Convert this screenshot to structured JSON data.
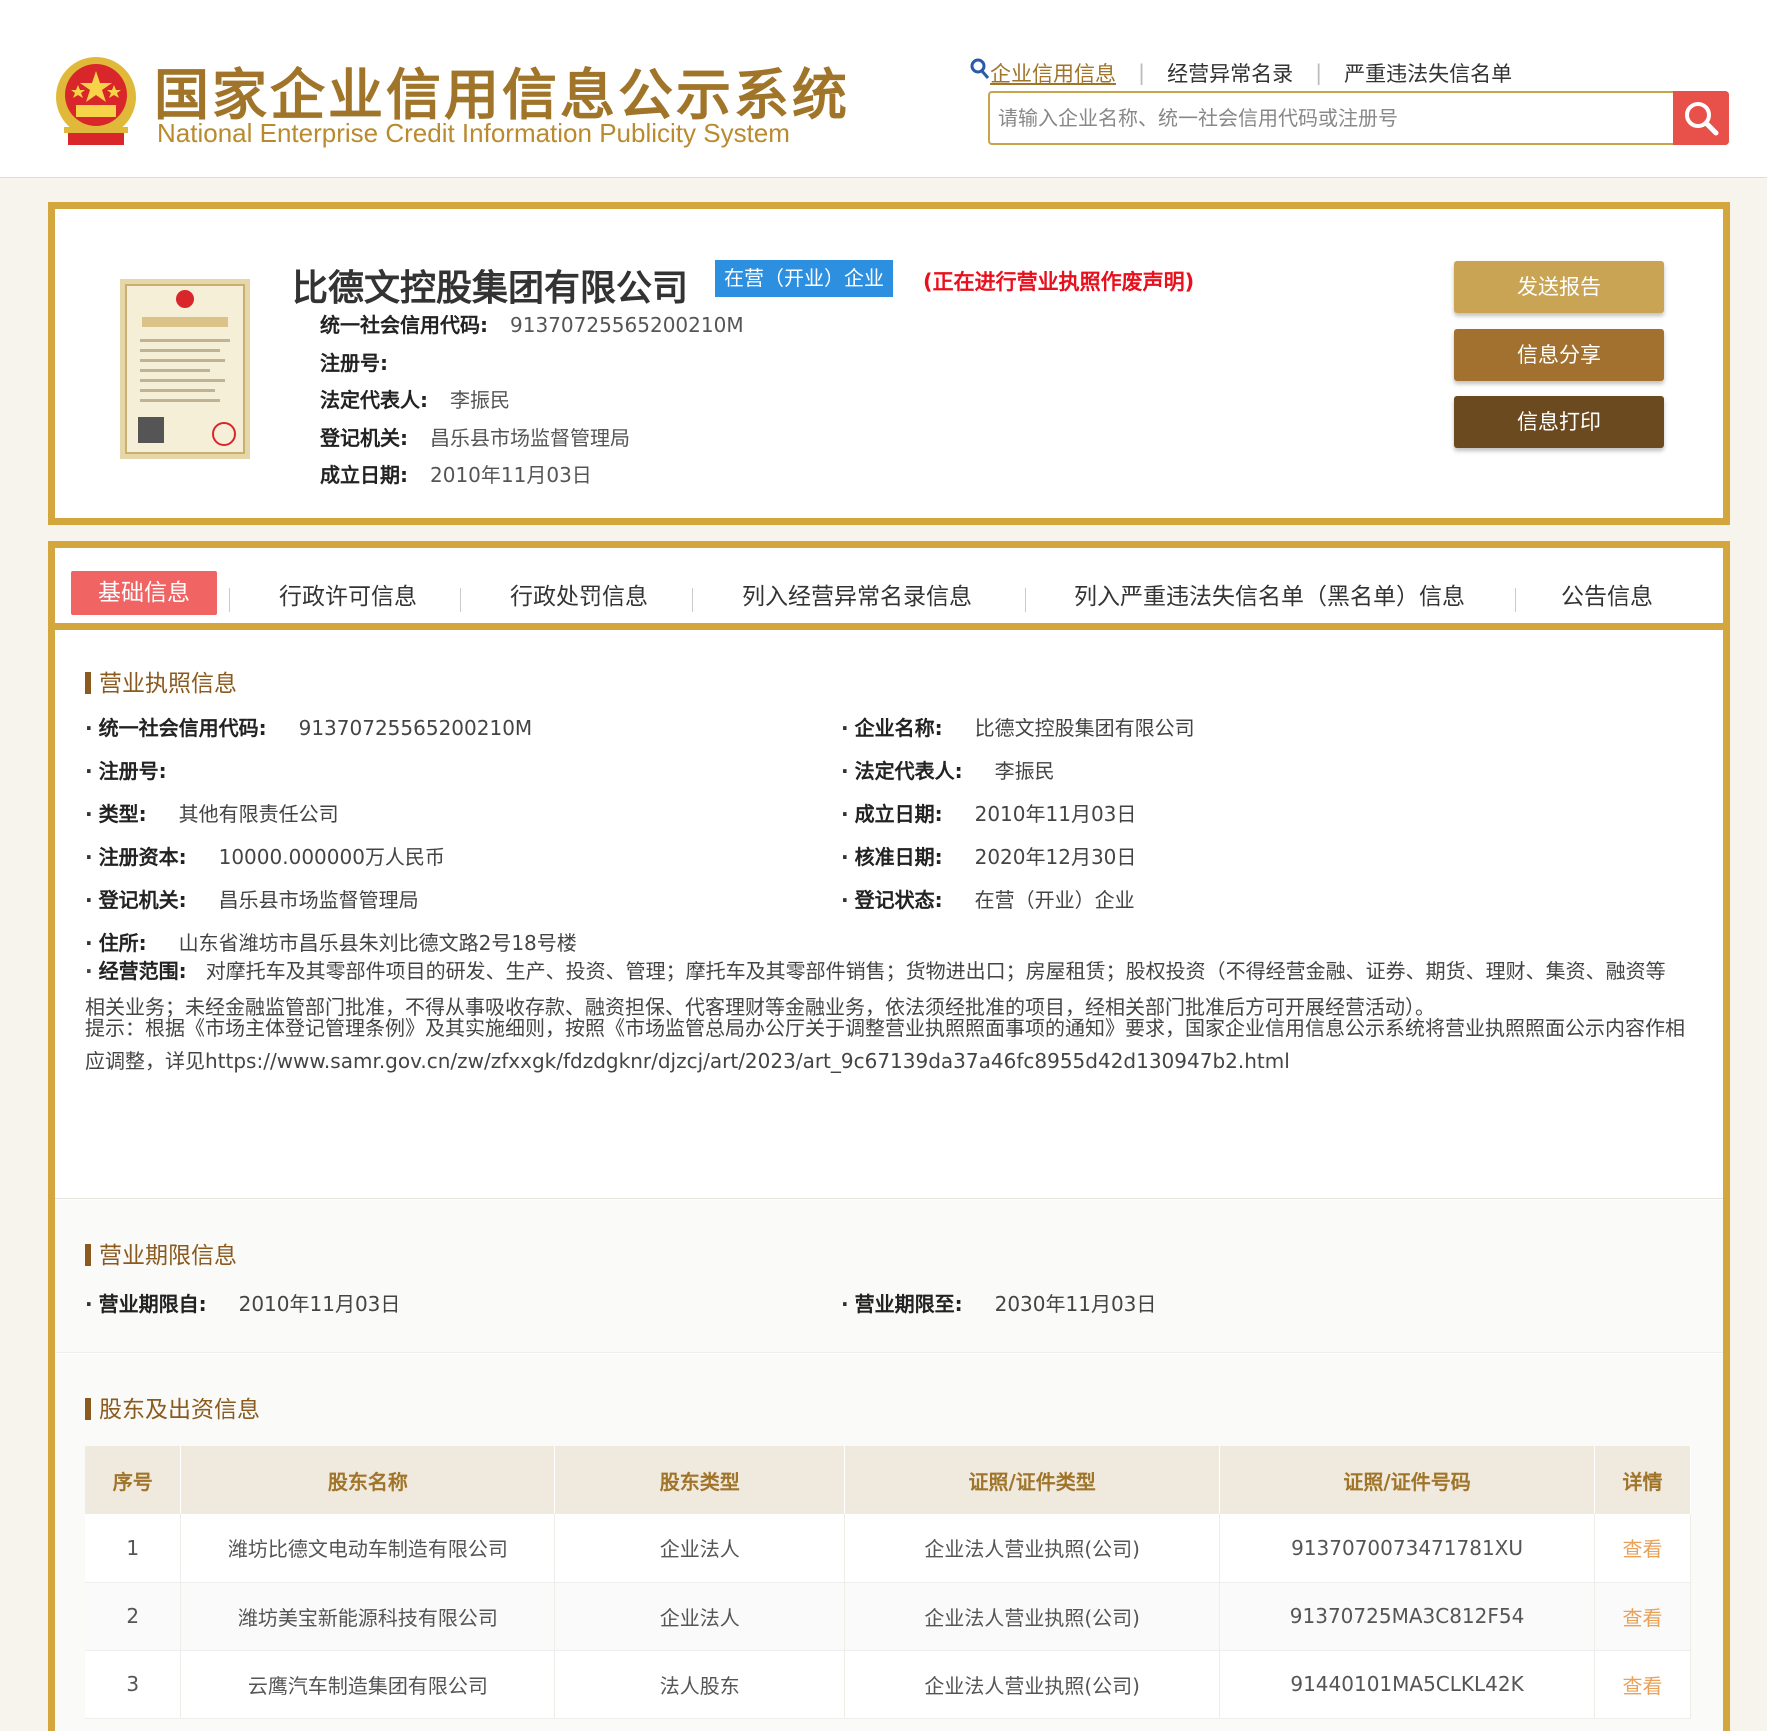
{
  "header": {
    "title": "国家企业信用信息公示系统",
    "subtitle": "National Enterprise Credit Information Publicity System",
    "nav": [
      "企业信用信息",
      "经营异常名录",
      "严重违法失信名单"
    ],
    "search_placeholder": "请输入企业名称、统一社会信用代码或注册号"
  },
  "company": {
    "name": "比德文控股集团有限公司",
    "status": "在营（开业）企业",
    "warning": "(正在进行营业执照作废声明)",
    "fields": [
      {
        "label": "统一社会信用代码:",
        "value": "91370725565200210M"
      },
      {
        "label": "注册号:",
        "value": ""
      },
      {
        "label": "法定代表人:",
        "value": "李振民"
      },
      {
        "label": "登记机关:",
        "value": "昌乐县市场监督管理局"
      },
      {
        "label": "成立日期:",
        "value": "2010年11月03日"
      }
    ],
    "buttons": [
      "发送报告",
      "信息分享",
      "信息打印"
    ]
  },
  "tabs": [
    "基础信息",
    "行政许可信息",
    "行政处罚信息",
    "列入经营异常名录信息",
    "列入严重违法失信名单（黑名单）信息",
    "公告信息"
  ],
  "license": {
    "title": "营业执照信息",
    "left": [
      {
        "label": "统一社会信用代码:",
        "value": "91370725565200210M"
      },
      {
        "label": "注册号:",
        "value": ""
      },
      {
        "label": "类型:",
        "value": "其他有限责任公司"
      },
      {
        "label": "注册资本:",
        "value": "10000.000000万人民币"
      },
      {
        "label": "登记机关:",
        "value": "昌乐县市场监督管理局"
      },
      {
        "label": "住所:",
        "value": "山东省潍坊市昌乐县朱刘比德文路2号18号楼"
      }
    ],
    "right": [
      {
        "label": "企业名称:",
        "value": "比德文控股集团有限公司"
      },
      {
        "label": "法定代表人:",
        "value": "李振民"
      },
      {
        "label": "成立日期:",
        "value": "2010年11月03日"
      },
      {
        "label": "核准日期:",
        "value": "2020年12月30日"
      },
      {
        "label": "登记状态:",
        "value": "在营（开业）企业"
      }
    ],
    "scope_label": "经营范围:",
    "scope": "对摩托车及其零部件项目的研发、生产、投资、管理；摩托车及其零部件销售；货物进出口；房屋租赁；股权投资（不得经营金融、证券、期货、理财、集资、融资等相关业务；未经金融监管部门批准，不得从事吸收存款、融资担保、代客理财等金融业务，依法须经批准的项目，经相关部门批准后方可开展经营活动）。",
    "notice": "提示：根据《市场主体登记管理条例》及其实施细则，按照《市场监管总局办公厅关于调整营业执照照面事项的通知》要求，国家企业信用信息公示系统将营业执照照面公示内容作相应调整，详见https://www.samr.gov.cn/zw/zfxxgk/fdzdgknr/djzcj/art/2023/art_9c67139da37a46fc8955d42d130947b2.html"
  },
  "term": {
    "title": "营业期限信息",
    "from_label": "营业期限自:",
    "from": "2010年11月03日",
    "to_label": "营业期限至:",
    "to": "2030年11月03日"
  },
  "shareholders": {
    "title": "股东及出资信息",
    "columns": [
      "序号",
      "股东名称",
      "股东类型",
      "证照/证件类型",
      "证照/证件号码",
      "详情"
    ],
    "rows": [
      [
        "1",
        "潍坊比德文电动车制造有限公司",
        "企业法人",
        "企业法人营业执照(公司)",
        "9137070073471781XU",
        "查看"
      ],
      [
        "2",
        "潍坊美宝新能源科技有限公司",
        "企业法人",
        "企业法人营业执照(公司)",
        "91370725MA3C812F54",
        "查看"
      ],
      [
        "3",
        "云鹰汽车制造集团有限公司",
        "法人股东",
        "企业法人营业执照(公司)",
        "91440101MA5CLKL42K",
        "查看"
      ]
    ]
  },
  "colors": {
    "gold": "#d4a63e",
    "brown": "#8b5a1e",
    "active_tab": "#f06464",
    "badge": "#2c8fe0",
    "warning": "#e8101d"
  }
}
